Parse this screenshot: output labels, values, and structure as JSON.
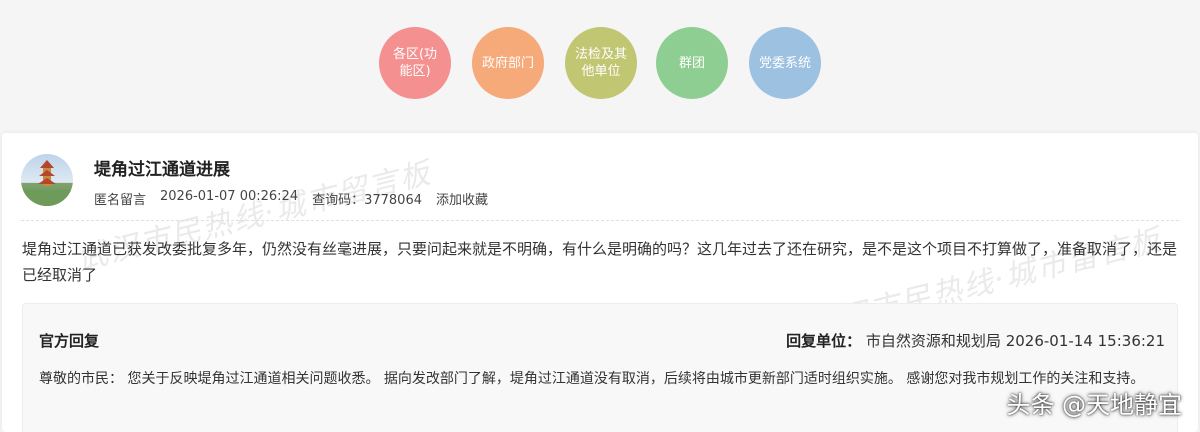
{
  "categories": [
    {
      "label_line1": "各区(功",
      "label_line2": "能区)",
      "color": "#f49090"
    },
    {
      "label_line1": "政府部门",
      "label_line2": "",
      "color": "#f6a979"
    },
    {
      "label_line1": "法检及其",
      "label_line2": "他单位",
      "color": "#c1c673"
    },
    {
      "label_line1": "群团",
      "label_line2": "",
      "color": "#8fce92"
    },
    {
      "label_line1": "党委系统",
      "label_line2": "",
      "color": "#9cc1e1"
    }
  ],
  "post": {
    "title": "堤角过江通道进展",
    "author": "匿名留言",
    "datetime": "2026-01-07 00:26:24",
    "query_code": "查询码：3778064",
    "favorite": "添加收藏",
    "content": "堤角过江通道已获发改委批复多年，仍然没有丝毫进展，只要问起来就是不明确，有什么是明确的吗？这几年过去了还在研究，是不是这个项目不打算做了，准备取消了，还是已经取消了"
  },
  "reply": {
    "heading": "官方回复",
    "unit_label": "回复单位：",
    "unit_name": "市自然资源和规划局",
    "datetime": "2026-01-14 15:36:21",
    "content": "尊敬的市民： 您关于反映堤角过江通道相关问题收悉。 据向发改部门了解，堤角过江通道没有取消，后续将由城市更新部门适时组织实施。 感谢您对我市规划工作的关注和支持。"
  },
  "watermark": "武汉市民热线·城市留言板",
  "credit": "头条 @天地静宜"
}
